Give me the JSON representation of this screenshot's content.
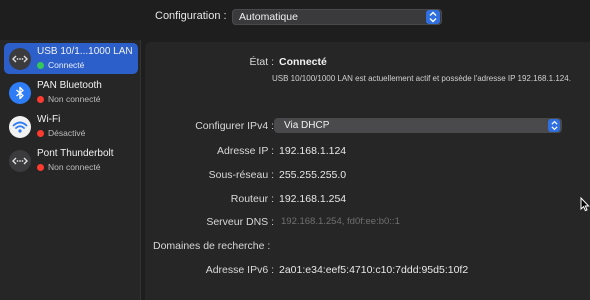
{
  "config": {
    "label": "Configuration :",
    "value": "Automatique"
  },
  "sidebar": {
    "items": [
      {
        "name": "USB 10/1...1000 LAN",
        "status": "Connecté",
        "status_color": "#34c759",
        "icon": "ethernet-icon",
        "selected": true
      },
      {
        "name": "PAN Bluetooth",
        "status": "Non connecté",
        "status_color": "#ff3b30",
        "icon": "bluetooth-icon",
        "selected": false
      },
      {
        "name": "Wi-Fi",
        "status": "Désactivé",
        "status_color": "#ff3b30",
        "icon": "wifi-icon",
        "selected": false
      },
      {
        "name": "Pont Thunderbolt",
        "status": "Non connecté",
        "status_color": "#ff3b30",
        "icon": "ethernet-icon",
        "selected": false
      }
    ]
  },
  "detail": {
    "etat_label": "État :",
    "etat_value": "Connecté",
    "etat_desc": "USB 10/100/1000 LAN est actuellement actif et possède l'adresse IP 192.168.1.124.",
    "ipv4_config_label": "Configurer IPv4 :",
    "ipv4_config_value": "Via DHCP",
    "ip_label": "Adresse IP :",
    "ip_value": "192.168.1.124",
    "mask_label": "Sous-réseau :",
    "mask_value": "255.255.255.0",
    "router_label": "Routeur :",
    "router_value": "192.168.1.254",
    "dns_label": "Serveur DNS :",
    "dns_value": "192.168.1.254, fd0f:ee:b0::1",
    "search_label": "Domaines de recherche :",
    "ipv6_label": "Adresse IPv6 :",
    "ipv6_value": "2a01:e34:eef5:4710:c10:7ddd:95d5:10f2"
  },
  "colors": {
    "accent": "#2c5fc9",
    "connected": "#34c759",
    "disconnected": "#ff3b30"
  }
}
